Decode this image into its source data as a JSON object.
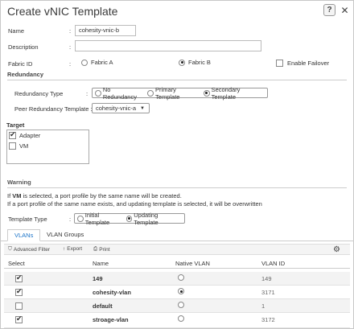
{
  "dialog": {
    "title": "Create vNIC Template",
    "help_label": "?",
    "close_label": "✕"
  },
  "form": {
    "name_label": "Name",
    "name_value": "cohesity-vnic-b",
    "description_label": "Description",
    "description_value": "",
    "fabric_label": "Fabric ID",
    "fabric_a": "Fabric A",
    "fabric_b": "Fabric B",
    "fabric_selected": "Fabric B",
    "failover_label": "Enable Failover",
    "failover_checked": false
  },
  "redundancy": {
    "section": "Redundancy",
    "type_label": "Redundancy Type",
    "options": [
      "No Redundancy",
      "Primary Template",
      "Secondary Template"
    ],
    "selected": "Secondary Template",
    "peer_label": "Peer Redundancy Template :",
    "peer_value": "cohesity-vnic-a"
  },
  "target": {
    "section": "Target",
    "items": [
      {
        "label": "Adapter",
        "checked": true
      },
      {
        "label": "VM",
        "checked": false
      }
    ]
  },
  "warning": {
    "section": "Warning",
    "line1_prefix": "If ",
    "line1_bold": "VM",
    "line1_rest": " is selected, a port profile by the same name will be created.",
    "line2": "If a port profile of the same name exists, and updating template is selected, it will be overwritten"
  },
  "template_type": {
    "label": "Template Type",
    "options": [
      "Initial Template",
      "Updating Template"
    ],
    "selected": "Updating Template"
  },
  "tabs": [
    "VLANs",
    "VLAN Groups"
  ],
  "active_tab": "VLANs",
  "toolbar": {
    "filter": "Advanced Filter",
    "export": "Export",
    "print": "Print"
  },
  "table": {
    "headers": [
      "Select",
      "Name",
      "Native VLAN",
      "VLAN ID"
    ],
    "rows": [
      {
        "selected": true,
        "name": "149",
        "native": false,
        "vlan_id": "149"
      },
      {
        "selected": true,
        "name": "cohesity-vlan",
        "native": true,
        "vlan_id": "3171"
      },
      {
        "selected": false,
        "name": "default",
        "native": false,
        "vlan_id": "1"
      },
      {
        "selected": true,
        "name": "stroage-vlan",
        "native": false,
        "vlan_id": "3172"
      }
    ]
  }
}
